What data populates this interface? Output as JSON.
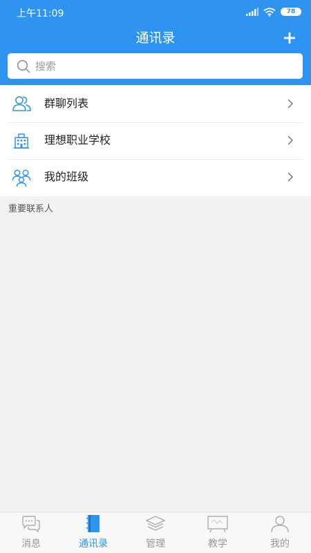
{
  "status_bar": {
    "time": "上午11:09",
    "battery": "78"
  },
  "header": {
    "title": "通讯录",
    "add_icon": "plus-icon"
  },
  "search": {
    "placeholder": "搜索",
    "value": ""
  },
  "menu": {
    "items": [
      {
        "label": "群聊列表",
        "icon": "group-chat-icon"
      },
      {
        "label": "理想职业学校",
        "icon": "school-building-icon"
      },
      {
        "label": "我的班级",
        "icon": "class-members-icon"
      }
    ]
  },
  "section": {
    "important_contacts": "重要联系人"
  },
  "tabs": {
    "items": [
      {
        "label": "消息",
        "icon": "chat-bubble-icon",
        "active": false
      },
      {
        "label": "通讯录",
        "icon": "address-book-icon",
        "active": true
      },
      {
        "label": "管理",
        "icon": "layers-icon",
        "active": false
      },
      {
        "label": "教学",
        "icon": "blackboard-icon",
        "active": false
      },
      {
        "label": "我的",
        "icon": "person-icon",
        "active": false
      }
    ]
  },
  "colors": {
    "primary": "#2f93f0",
    "background": "#f2f2f2",
    "tab_inactive": "#999999"
  }
}
